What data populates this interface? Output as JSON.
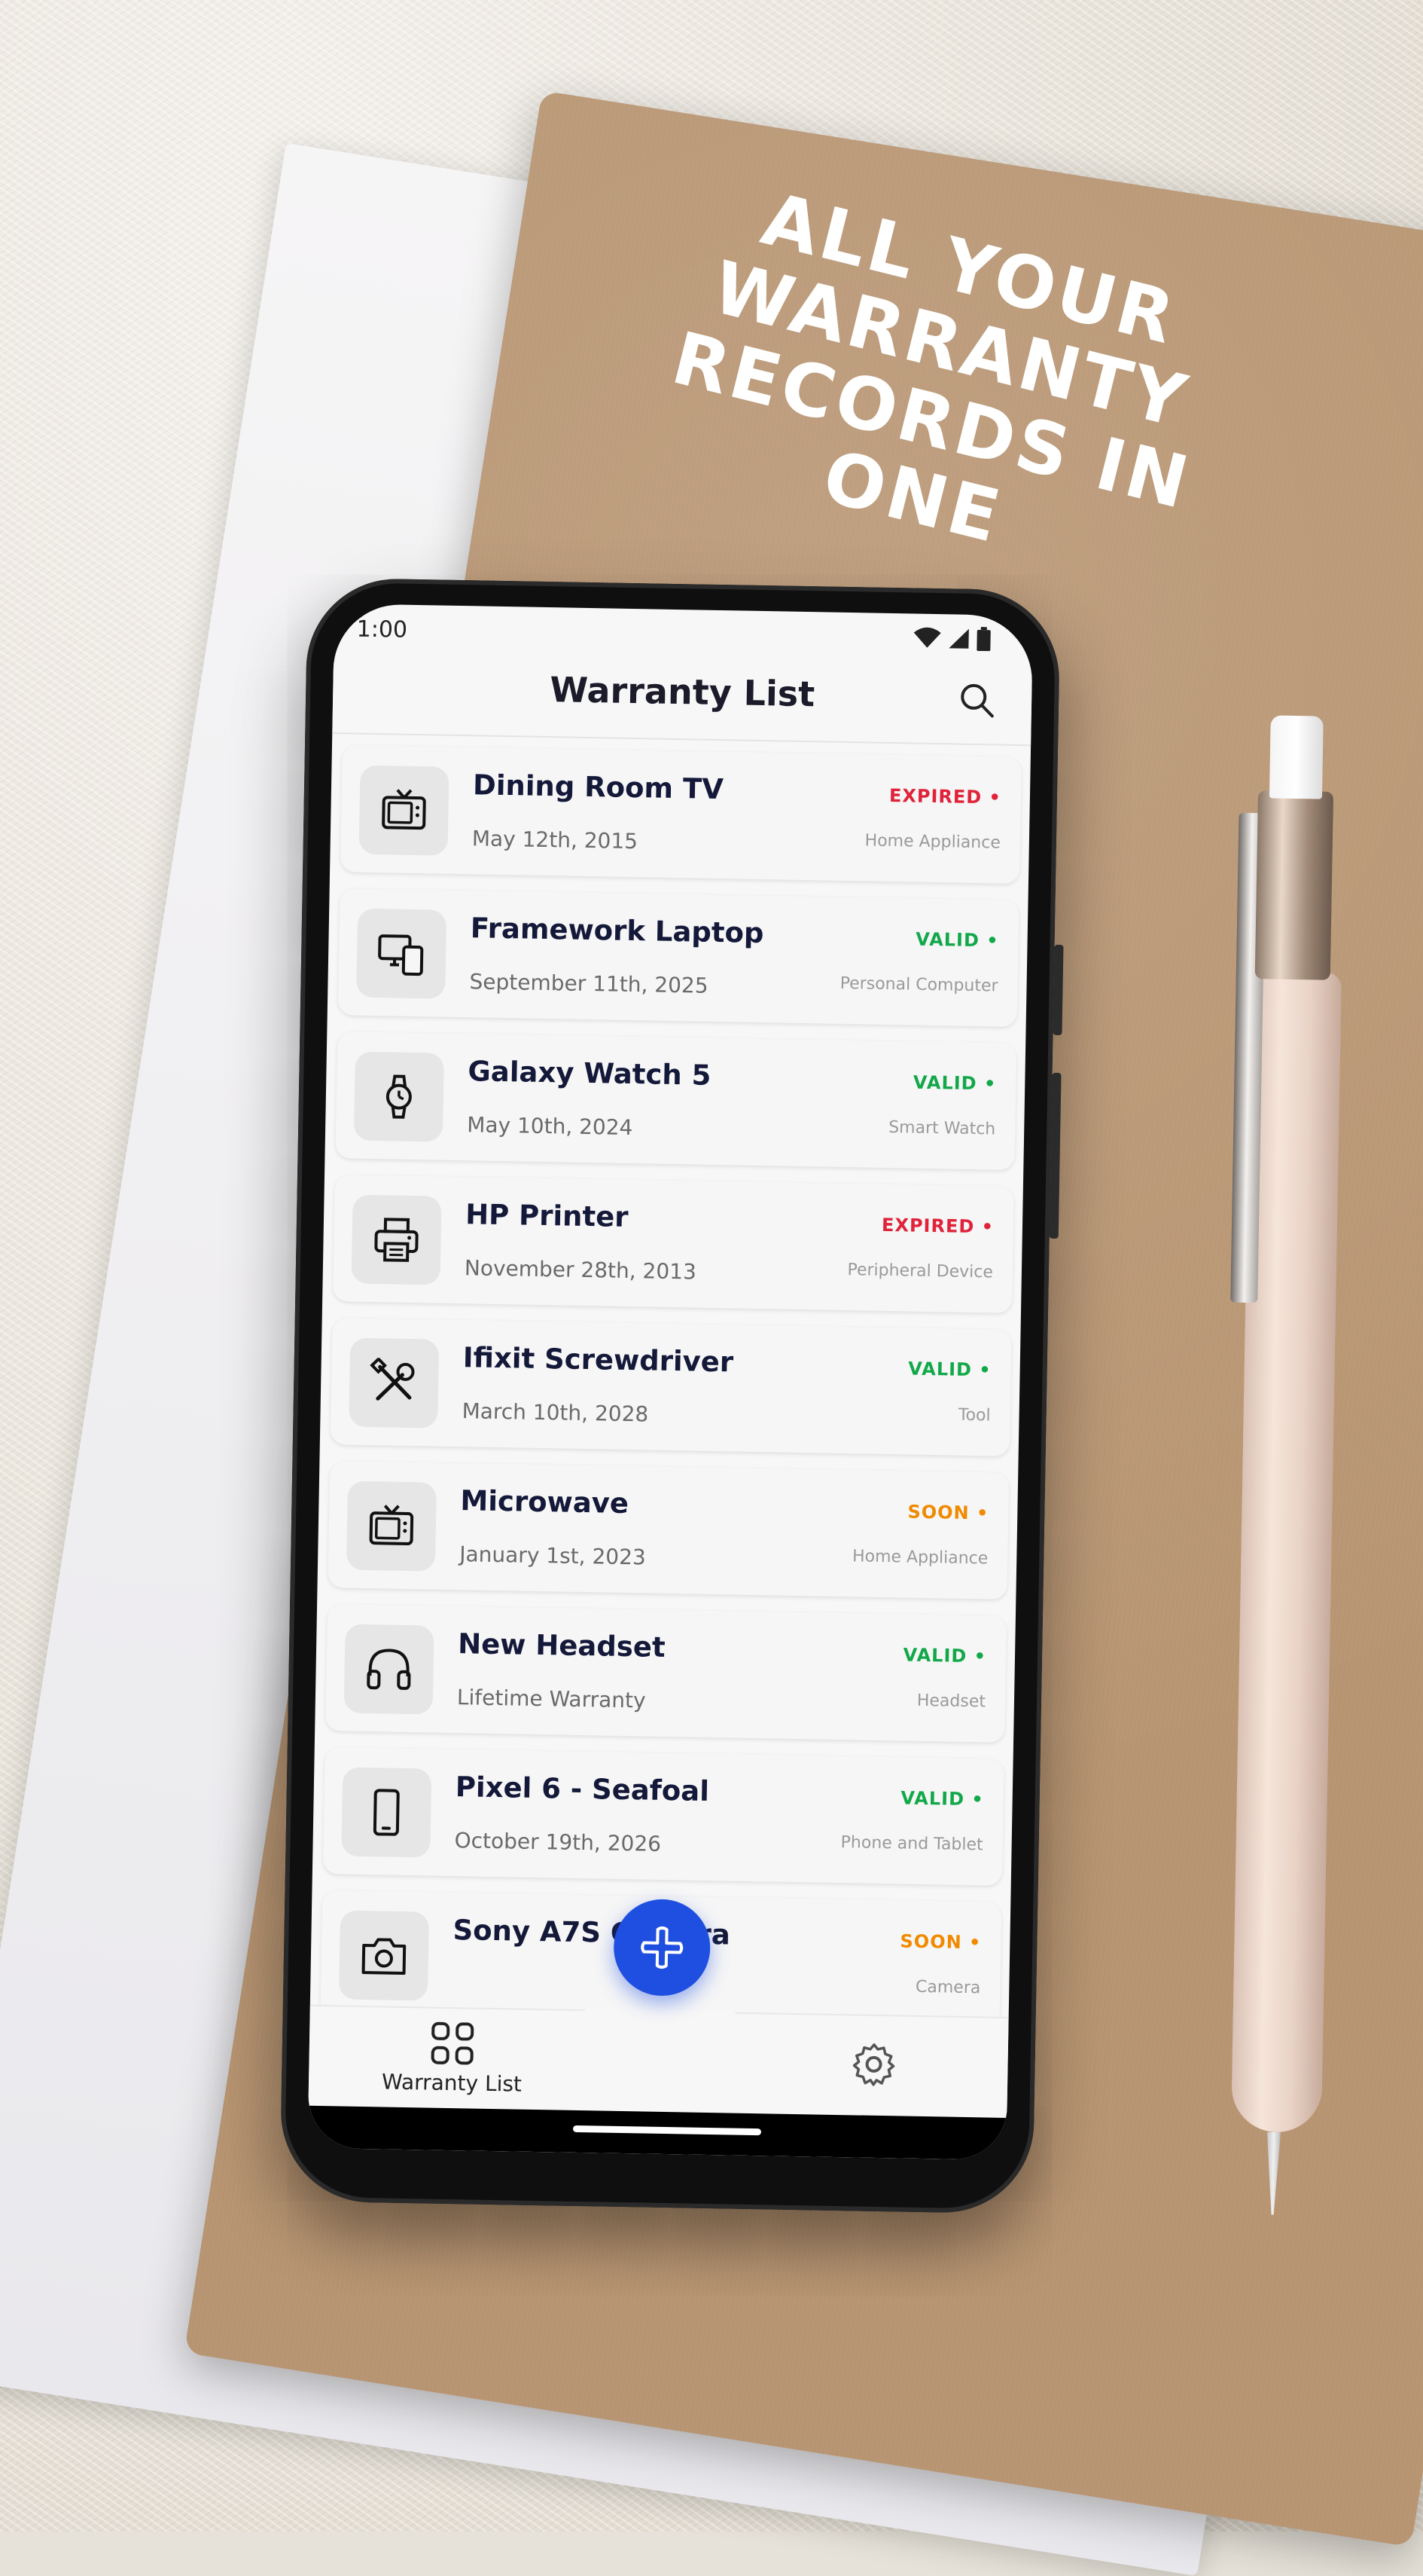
{
  "headline": {
    "line1": "ALL YOUR",
    "line2": "WARRANTY",
    "line3": "RECORDS IN ONE"
  },
  "status_bar": {
    "time": "1:00",
    "icons": [
      "wifi-icon",
      "signal-icon",
      "battery-icon"
    ]
  },
  "header": {
    "title": "Warranty List",
    "search_icon": "search-icon"
  },
  "colors": {
    "expired": "#e0233a",
    "valid": "#12a84a",
    "soon": "#f08a00",
    "fab": "#1f4fe0",
    "title_text": "#14193a"
  },
  "warranties": [
    {
      "name": "Dining Room TV",
      "date": "May 12th, 2015",
      "status": "EXPIRED",
      "category": "Home Appliance",
      "icon": "tv-icon"
    },
    {
      "name": "Framework Laptop",
      "date": "September 11th, 2025",
      "status": "VALID",
      "category": "Personal Computer",
      "icon": "devices-icon"
    },
    {
      "name": "Galaxy Watch 5",
      "date": "May 10th, 2024",
      "status": "VALID",
      "category": "Smart Watch",
      "icon": "watch-icon"
    },
    {
      "name": "HP Printer",
      "date": "November 28th, 2013",
      "status": "EXPIRED",
      "category": "Peripheral Device",
      "icon": "printer-icon"
    },
    {
      "name": "Ifixit Screwdriver",
      "date": "March 10th, 2028",
      "status": "VALID",
      "category": "Tool",
      "icon": "tools-icon"
    },
    {
      "name": "Microwave",
      "date": "January 1st, 2023",
      "status": "SOON",
      "category": "Home Appliance",
      "icon": "tv-icon"
    },
    {
      "name": "New Headset",
      "date": "Lifetime Warranty",
      "status": "VALID",
      "category": "Headset",
      "icon": "headphones-icon"
    },
    {
      "name": "Pixel 6 - Seafoal",
      "date": "October 19th, 2026",
      "status": "VALID",
      "category": "Phone and Tablet",
      "icon": "phone-icon"
    },
    {
      "name": "Sony A7S Camera",
      "date": "",
      "status": "SOON",
      "category": "Camera",
      "icon": "camera-icon"
    }
  ],
  "nav": {
    "items": [
      {
        "label": "Warranty List",
        "icon": "grid-icon"
      },
      {
        "label": "",
        "icon": "settings-icon"
      }
    ],
    "fab_icon": "plus-icon"
  }
}
